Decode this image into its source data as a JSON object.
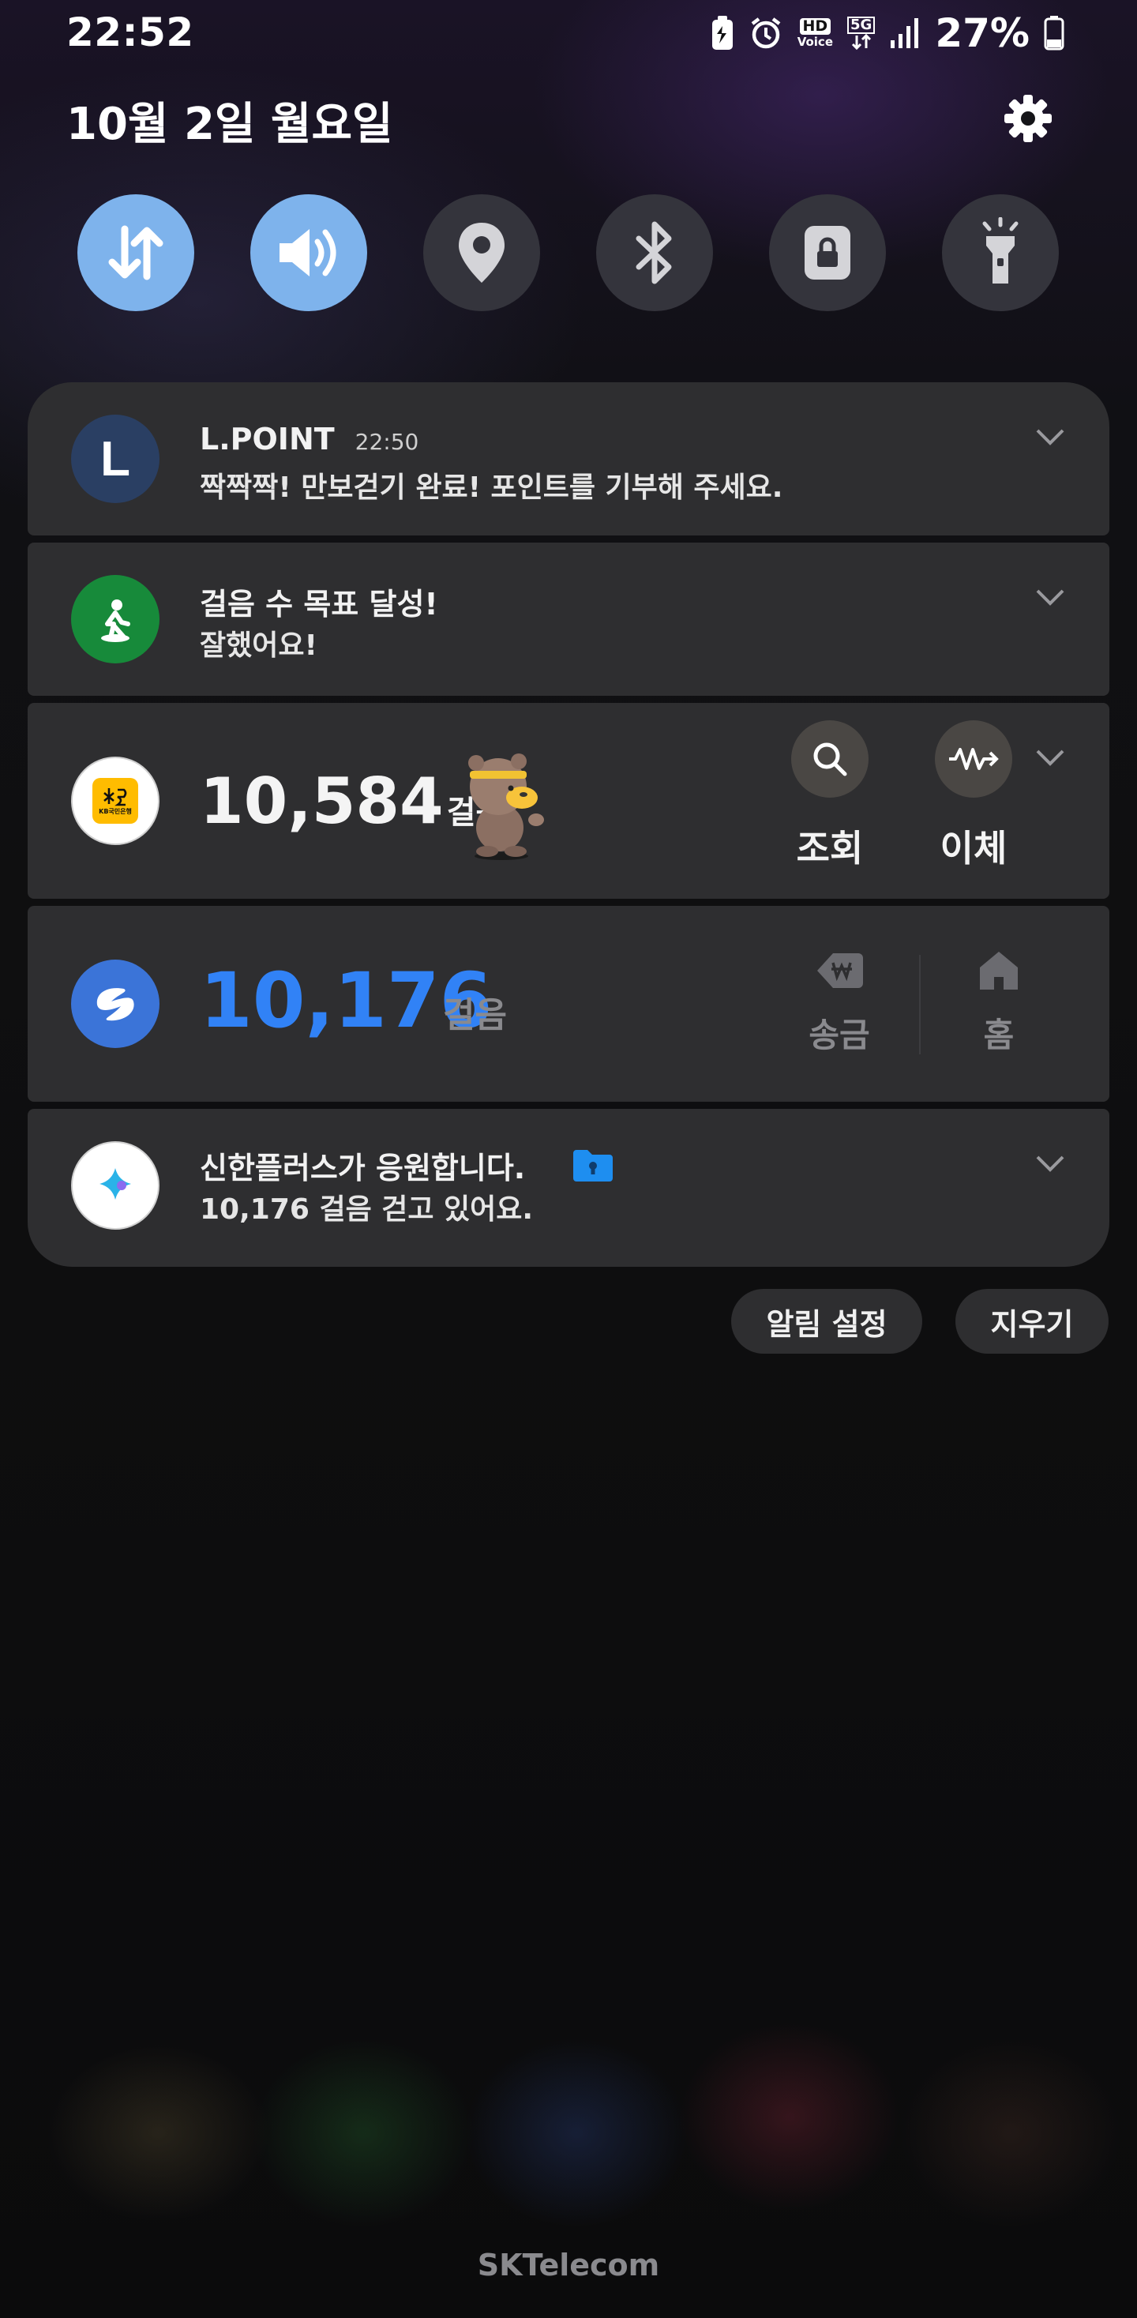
{
  "status_bar": {
    "time": "22:52",
    "hd_label": "HD",
    "voice_label": "Voice",
    "network_label": "5G",
    "battery_percent": "27%",
    "icons": [
      "battery-saver-icon",
      "alarm-icon",
      "hd-voice-icon",
      "5g-data-icon",
      "signal-icon",
      "battery-icon"
    ]
  },
  "header": {
    "date": "10월 2일 월요일",
    "settings_icon": "gear-icon"
  },
  "quick_settings": [
    {
      "name": "mobile-data",
      "icon": "data-arrows-icon",
      "active": true
    },
    {
      "name": "sound",
      "icon": "speaker-icon",
      "active": true
    },
    {
      "name": "location",
      "icon": "location-pin-icon",
      "active": false
    },
    {
      "name": "bluetooth",
      "icon": "bluetooth-icon",
      "active": false
    },
    {
      "name": "rotation-lock",
      "icon": "lock-icon",
      "active": false
    },
    {
      "name": "flashlight",
      "icon": "flashlight-icon",
      "active": false
    }
  ],
  "notifications": {
    "lpoint": {
      "app_letter": "L",
      "title": "L.POINT",
      "time": "22:50",
      "text": "짝짝짝! 만보걷기 완료! 포인트를 기부해 주세요."
    },
    "goal": {
      "title": "걸음 수 목표 달성!",
      "text": "잘했어요!"
    },
    "kb": {
      "logo_text": "KB국민은행",
      "steps": "10,584",
      "unit": "걸음",
      "actions": [
        {
          "label": "조회",
          "icon": "search-icon"
        },
        {
          "label": "이체",
          "icon": "transfer-icon"
        }
      ]
    },
    "toss": {
      "steps": "10,176",
      "unit": "걸음",
      "actions": [
        {
          "label": "송금",
          "icon": "won-send-icon"
        },
        {
          "label": "홈",
          "icon": "home-icon"
        }
      ]
    },
    "shinhan": {
      "title": "신한플러스가 응원합니다.",
      "text": "10,176 걸음 걷고 있어요."
    }
  },
  "panel_actions": {
    "settings_label": "알림 설정",
    "clear_label": "지우기"
  },
  "carrier": "SKTelecom",
  "colors": {
    "toggle_on": "#7eb3ec",
    "toggle_off": "#34343c",
    "card_bg": "#2e2e30",
    "steps_blue": "#3182f6",
    "lpoint_icon": "#2a3f63",
    "goal_icon": "#178a3a",
    "toss_icon": "#3b74d8"
  }
}
